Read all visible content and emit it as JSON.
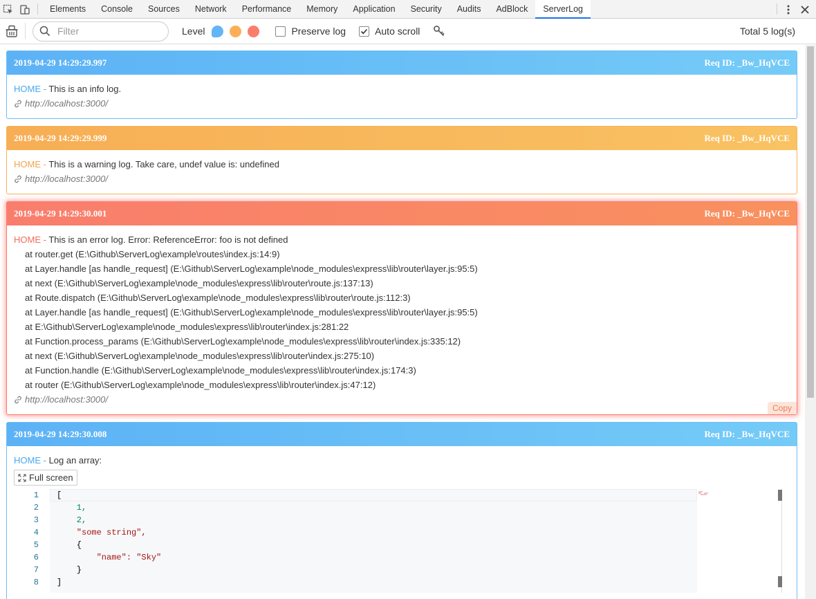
{
  "devtools": {
    "tabs": [
      "Elements",
      "Console",
      "Sources",
      "Network",
      "Performance",
      "Memory",
      "Application",
      "Security",
      "Audits",
      "AdBlock",
      "ServerLog"
    ],
    "active_tab": "ServerLog"
  },
  "toolbar": {
    "filter_placeholder": "Filter",
    "level_label": "Level",
    "preserve_log_label": "Preserve log",
    "preserve_log_checked": false,
    "auto_scroll_label": "Auto scroll",
    "auto_scroll_checked": true,
    "total_label": "Total 5 log(s)"
  },
  "colors": {
    "info": "#5cb2f5",
    "warn": "#f7ae55",
    "error": "#f97d6d",
    "active_tab_underline": "#1a73e8"
  },
  "logs": [
    {
      "level": "info",
      "timestamp": "2019-04-29 14:29:29.997",
      "req_id": "Req ID: _Bw_HqVCE",
      "tag": "HOME",
      "separator": " - ",
      "message": "This is an info log.",
      "url": "http://localhost:3000/"
    },
    {
      "level": "warn",
      "timestamp": "2019-04-29 14:29:29.999",
      "req_id": "Req ID: _Bw_HqVCE",
      "tag": "HOME",
      "separator": " - ",
      "message": "This is a warning log. Take care, undef value is: undefined",
      "url": "http://localhost:3000/"
    },
    {
      "level": "error",
      "timestamp": "2019-04-29 14:29:30.001",
      "req_id": "Req ID: _Bw_HqVCE",
      "tag": "HOME",
      "separator": " - ",
      "message": "This is an error log. Error: ReferenceError: foo is not defined",
      "stack": [
        "at router.get (E:\\Github\\ServerLog\\example\\routes\\index.js:14:9)",
        "at Layer.handle [as handle_request] (E:\\Github\\ServerLog\\example\\node_modules\\express\\lib\\router\\layer.js:95:5)",
        "at next (E:\\Github\\ServerLog\\example\\node_modules\\express\\lib\\router\\route.js:137:13)",
        "at Route.dispatch (E:\\Github\\ServerLog\\example\\node_modules\\express\\lib\\router\\route.js:112:3)",
        "at Layer.handle [as handle_request] (E:\\Github\\ServerLog\\example\\node_modules\\express\\lib\\router\\layer.js:95:5)",
        "at E:\\Github\\ServerLog\\example\\node_modules\\express\\lib\\router\\index.js:281:22",
        "at Function.process_params (E:\\Github\\ServerLog\\example\\node_modules\\express\\lib\\router\\index.js:335:12)",
        "at next (E:\\Github\\ServerLog\\example\\node_modules\\express\\lib\\router\\index.js:275:10)",
        "at Function.handle (E:\\Github\\ServerLog\\example\\node_modules\\express\\lib\\router\\index.js:174:3)",
        "at router (E:\\Github\\ServerLog\\example\\node_modules\\express\\lib\\router\\index.js:47:12)"
      ],
      "url": "http://localhost:3000/",
      "copy_label": "Copy"
    },
    {
      "level": "info",
      "timestamp": "2019-04-29 14:29:30.008",
      "req_id": "Req ID: _Bw_HqVCE",
      "tag": "HOME",
      "separator": " - ",
      "message": "Log an array:",
      "fullscreen_label": "Full screen",
      "code_lines": [
        {
          "n": "1",
          "text": "["
        },
        {
          "n": "2",
          "text": "    1,"
        },
        {
          "n": "3",
          "text": "    2,"
        },
        {
          "n": "4",
          "text": "    \"some string\","
        },
        {
          "n": "5",
          "text": "    {"
        },
        {
          "n": "6",
          "text": "        \"name\": \"Sky\""
        },
        {
          "n": "7",
          "text": "    }"
        },
        {
          "n": "8",
          "text": "]"
        }
      ]
    }
  ]
}
